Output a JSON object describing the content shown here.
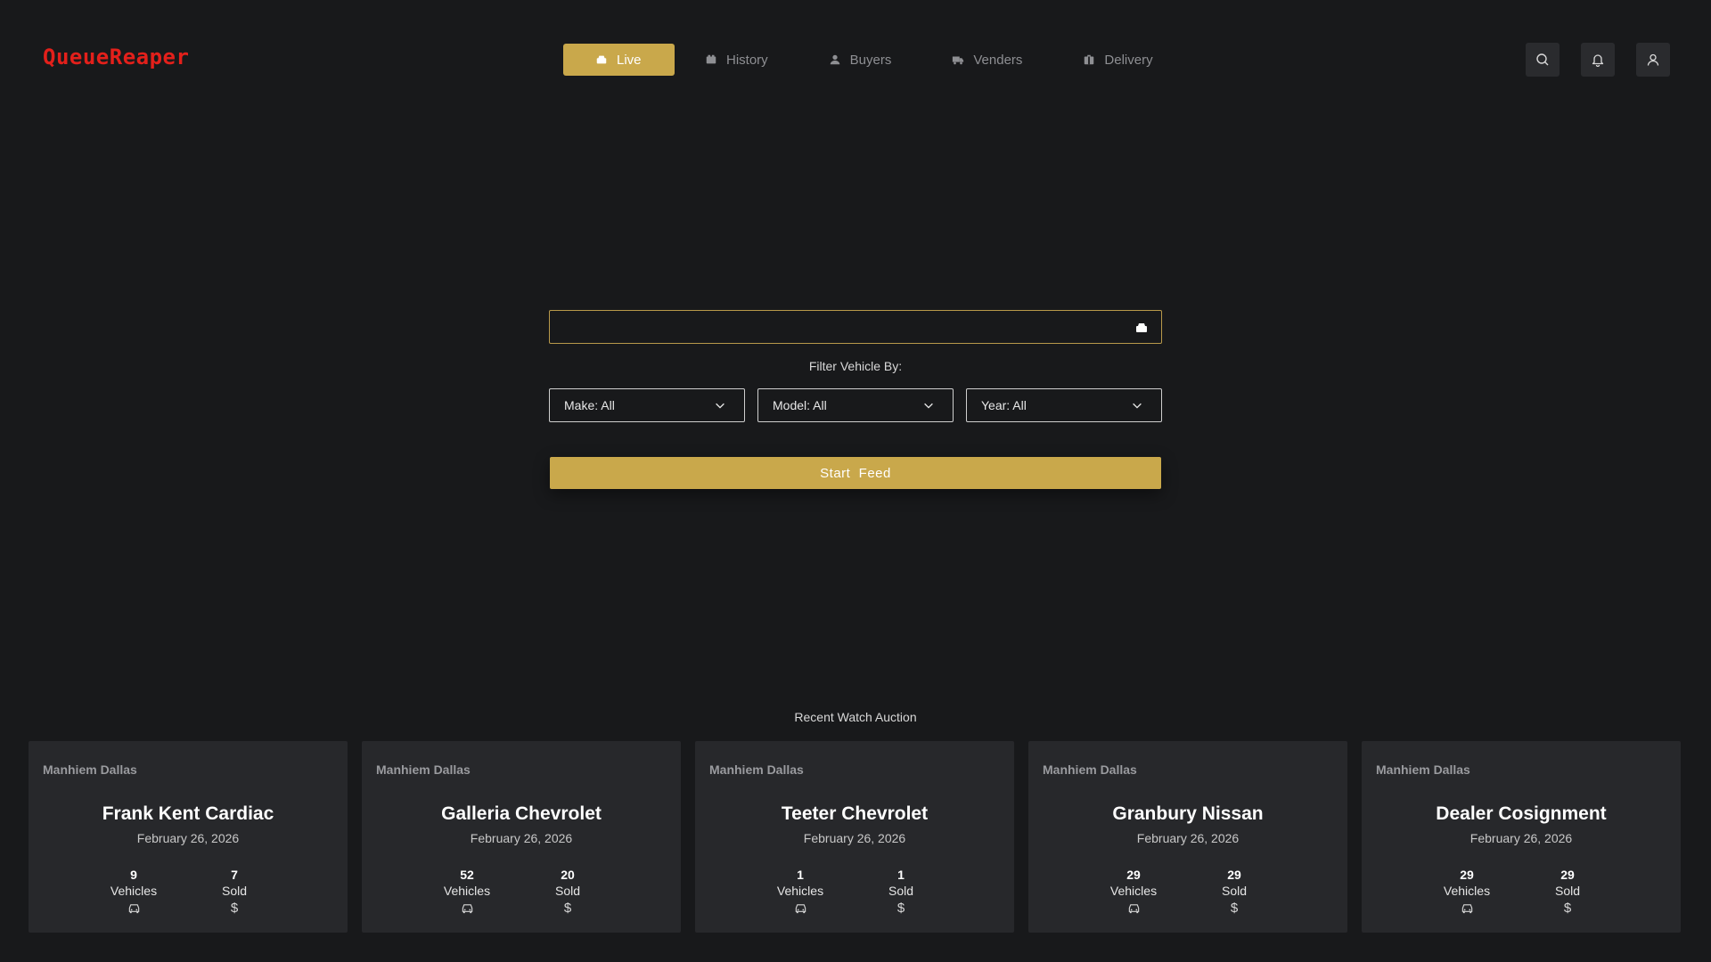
{
  "app": {
    "logo": "QueueReaper"
  },
  "nav": {
    "items": [
      {
        "label": "Live",
        "icon": "car-icon",
        "active": true
      },
      {
        "label": "History",
        "icon": "history-icon",
        "active": false
      },
      {
        "label": "Buyers",
        "icon": "user-icon",
        "active": false
      },
      {
        "label": "Venders",
        "icon": "truck-icon",
        "active": false
      },
      {
        "label": "Delivery",
        "icon": "package-icon",
        "active": false
      }
    ]
  },
  "header_actions": [
    "search-icon",
    "bell-icon",
    "user-icon"
  ],
  "search": {
    "value": "",
    "placeholder": ""
  },
  "filters": {
    "label": "Filter Vehicle By:",
    "make": "Make: All",
    "model": "Model: All",
    "year": "Year: All"
  },
  "start_button": "Start  Feed",
  "recent": {
    "title": "Recent Watch Auction",
    "cards": [
      {
        "location": "Manhiem Dallas",
        "name": "Frank Kent Cardiac",
        "date": "February 26, 2026",
        "vehicles": "9",
        "vehicles_label": "Vehicles",
        "sold": "7",
        "sold_label": "Sold",
        "sold_symbol": "$"
      },
      {
        "location": "Manhiem Dallas",
        "name": "Galleria Chevrolet",
        "date": "February 26, 2026",
        "vehicles": "52",
        "vehicles_label": "Vehicles",
        "sold": "20",
        "sold_label": "Sold",
        "sold_symbol": "$"
      },
      {
        "location": "Manhiem Dallas",
        "name": "Teeter Chevrolet",
        "date": "February 26, 2026",
        "vehicles": "1",
        "vehicles_label": "Vehicles",
        "sold": "1",
        "sold_label": "Sold",
        "sold_symbol": "$"
      },
      {
        "location": "Manhiem Dallas",
        "name": "Granbury Nissan",
        "date": "February 26, 2026",
        "vehicles": "29",
        "vehicles_label": "Vehicles",
        "sold": "29",
        "sold_label": "Sold",
        "sold_symbol": "$"
      },
      {
        "location": "Manhiem Dallas",
        "name": "Dealer Cosignment",
        "date": "February 26, 2026",
        "vehicles": "29",
        "vehicles_label": "Vehicles",
        "sold": "29",
        "sold_label": "Sold",
        "sold_symbol": "$"
      }
    ]
  },
  "colors": {
    "background": "#18191b",
    "accent": "#c9a84b",
    "logo": "#e3201b",
    "card": "#27282b",
    "nav_inactive": "#8e8f93"
  }
}
